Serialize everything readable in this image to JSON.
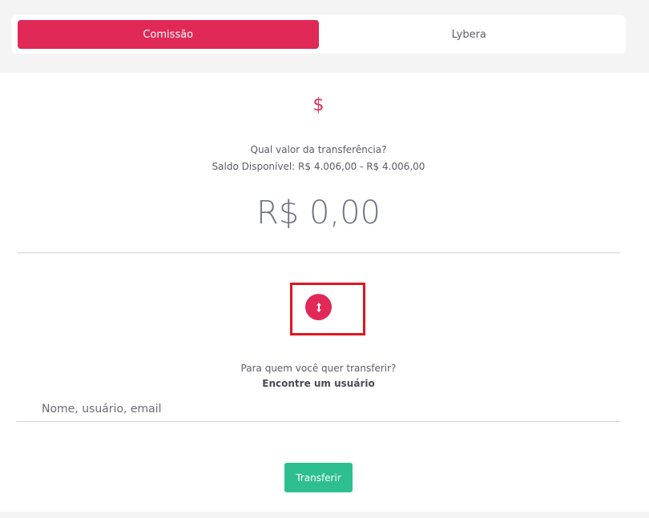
{
  "tabs": [
    {
      "label": "Comissão",
      "active": true
    },
    {
      "label": "Lybera",
      "active": false
    }
  ],
  "transfer": {
    "currency_icon": "$",
    "question": "Qual valor da transferência?",
    "balance_text": "Saldo Disponível:  R$ 4.006,00 - R$ 4.006,00",
    "amount": "R$ 0,00"
  },
  "recipient": {
    "question": "Para quem você quer transferir?",
    "find_label": "Encontre um usuário",
    "search_placeholder": "Nome, usuário, email",
    "search_value": ""
  },
  "actions": {
    "transfer_label": "Transferir"
  },
  "colors": {
    "accent": "#e12958",
    "success": "#2ebf91",
    "highlight": "#e0161e"
  },
  "icons": {
    "currency": "dollar-icon",
    "swap": "swap-vertical-icon"
  }
}
